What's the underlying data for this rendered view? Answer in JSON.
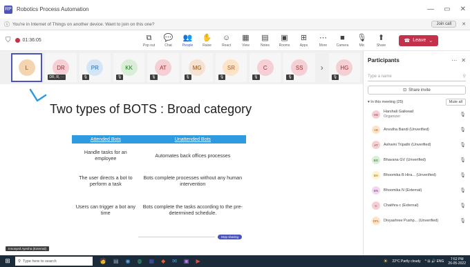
{
  "window": {
    "logo": "RP",
    "title": "Robotics Process Automation",
    "controls": [
      "—",
      "▭",
      "✕"
    ]
  },
  "infobar": {
    "message": "You're in Internet of Things on another device. Want to join on this one?",
    "join_label": "Join call",
    "close": "✕"
  },
  "toolbar": {
    "timer": "01:36:05",
    "tools": [
      {
        "label": "Pop out",
        "icon": "⧉"
      },
      {
        "label": "Chat",
        "icon": "💬"
      },
      {
        "label": "People",
        "icon": "👥",
        "active": true
      },
      {
        "label": "Raise",
        "icon": "✋"
      },
      {
        "label": "React",
        "icon": "☺"
      },
      {
        "label": "View",
        "icon": "▦"
      },
      {
        "label": "Notes",
        "icon": "▤"
      },
      {
        "label": "Rooms",
        "icon": "▣"
      },
      {
        "label": "Apps",
        "icon": "⊞"
      },
      {
        "label": "More",
        "icon": "⋯"
      },
      {
        "label": "Camera",
        "icon": "■"
      },
      {
        "label": "Mic",
        "icon": "🎙"
      },
      {
        "label": "Share",
        "icon": "⬆"
      }
    ],
    "leave_label": "Leave"
  },
  "video_strip": {
    "tiles": [
      {
        "initials": "L",
        "bg": "#f5d5b0",
        "fg": "#8a4b00",
        "selected": true
      },
      {
        "initials": "DR",
        "bg": "#f5cfd3",
        "fg": "#a4262c",
        "mic": "DR, R, ⋯"
      },
      {
        "initials": "PR",
        "bg": "#d4e5f7",
        "fg": "#0f6cbd",
        "mic": "🎙"
      },
      {
        "initials": "KK",
        "bg": "#d8eed6",
        "fg": "#107c10",
        "mic": "🎙"
      },
      {
        "initials": "AT",
        "bg": "#f5cfd3",
        "fg": "#a4262c",
        "mic": "🎙"
      },
      {
        "initials": "MG",
        "bg": "#f7e1d3",
        "fg": "#8a4b00",
        "mic": "🎙"
      },
      {
        "initials": "SR",
        "bg": "#fde4c7",
        "fg": "#c4531a",
        "mic": "🎙"
      },
      {
        "initials": "C",
        "bg": "#f5cfd3",
        "fg": "#a4262c",
        "mic": "🎙"
      },
      {
        "initials": "SS",
        "bg": "#f5cfd3",
        "fg": "#a4262c",
        "mic": "🎙"
      },
      {
        "initials": "HG",
        "bg": "#f5cfd3",
        "fg": "#a4262c",
        "mic": "🎙"
      }
    ],
    "next_arrow": "›"
  },
  "slide": {
    "title": "Two types of BOTS : Broad category",
    "table": {
      "headers": [
        "Attended Bots",
        "Unattended Bots"
      ],
      "rows": [
        [
          "Handle tasks for an employee",
          "Automates back offices processes"
        ],
        [
          "The user directs a bot to perform a task",
          "Bots complete processes without any human intervention"
        ],
        [
          "Users can trigger a bot any time",
          "Bots complete the tasks according to the pre-determined schedule."
        ]
      ]
    },
    "share_pill": "Stop sharing"
  },
  "presenter_tag": "Innosyed Ayesha (External)",
  "participants": {
    "title": "Participants",
    "more": "⋯",
    "close": "✕",
    "search_placeholder": "Type a name",
    "search_icon": "⚲",
    "share_invite": "Share invite",
    "share_icon": "⊡",
    "in_meeting": "▾ In this meeting (25)",
    "mute_all": "Mute all",
    "people": [
      {
        "initials": "HG",
        "name": "Harshali Gaikwad",
        "role": "Organizer",
        "bg": "#f5cfd3",
        "fg": "#a4262c"
      },
      {
        "initials": "AB",
        "name": "Anvutha Bandi (Unverified)",
        "role": "",
        "bg": "#fde4c7",
        "fg": "#c4531a"
      },
      {
        "initials": "AT",
        "name": "Ashwini Tripathi (Unverified)",
        "role": "",
        "bg": "#f5cfd3",
        "fg": "#a4262c"
      },
      {
        "initials": "BG",
        "name": "Bhavana GV (Unverified)",
        "role": "",
        "bg": "#d8eed6",
        "fg": "#107c10"
      },
      {
        "initials": "BH",
        "name": "Bhoomika B Hira... (Unverified)",
        "role": "",
        "bg": "#fff4ce",
        "fg": "#8a6d00"
      },
      {
        "initials": "BN",
        "name": "Bhoomika N (External)",
        "role": "",
        "bg": "#f1d7f0",
        "fg": "#8a2d89"
      },
      {
        "initials": "C",
        "name": "Chaithra c (External)",
        "role": "",
        "bg": "#f5cfd3",
        "fg": "#a4262c"
      },
      {
        "initials": "DPL",
        "name": "Divyashree Pushp... (Unverified)",
        "role": "",
        "bg": "#fde4c7",
        "fg": "#c4531a"
      }
    ],
    "mic_icon": "🎙"
  },
  "taskbar": {
    "start": "⊞",
    "search_text": "Type here to search",
    "search_icon": "⚲",
    "apps": [
      "🧑",
      "▤",
      "◉",
      "◍",
      "▦",
      "◆",
      "✉",
      "▣",
      "▶"
    ],
    "weather": "22°C Partly cloudy",
    "weather_icon": "☀",
    "tray": "^ ⊟ 🔊 ENG",
    "time": "7:52 PM",
    "date": "26-05-2022"
  },
  "colors": {
    "accent": "#4b53bc",
    "leave": "#c4314b",
    "table_header": "#2e9be0",
    "taskbar": "#1c2b3a"
  }
}
